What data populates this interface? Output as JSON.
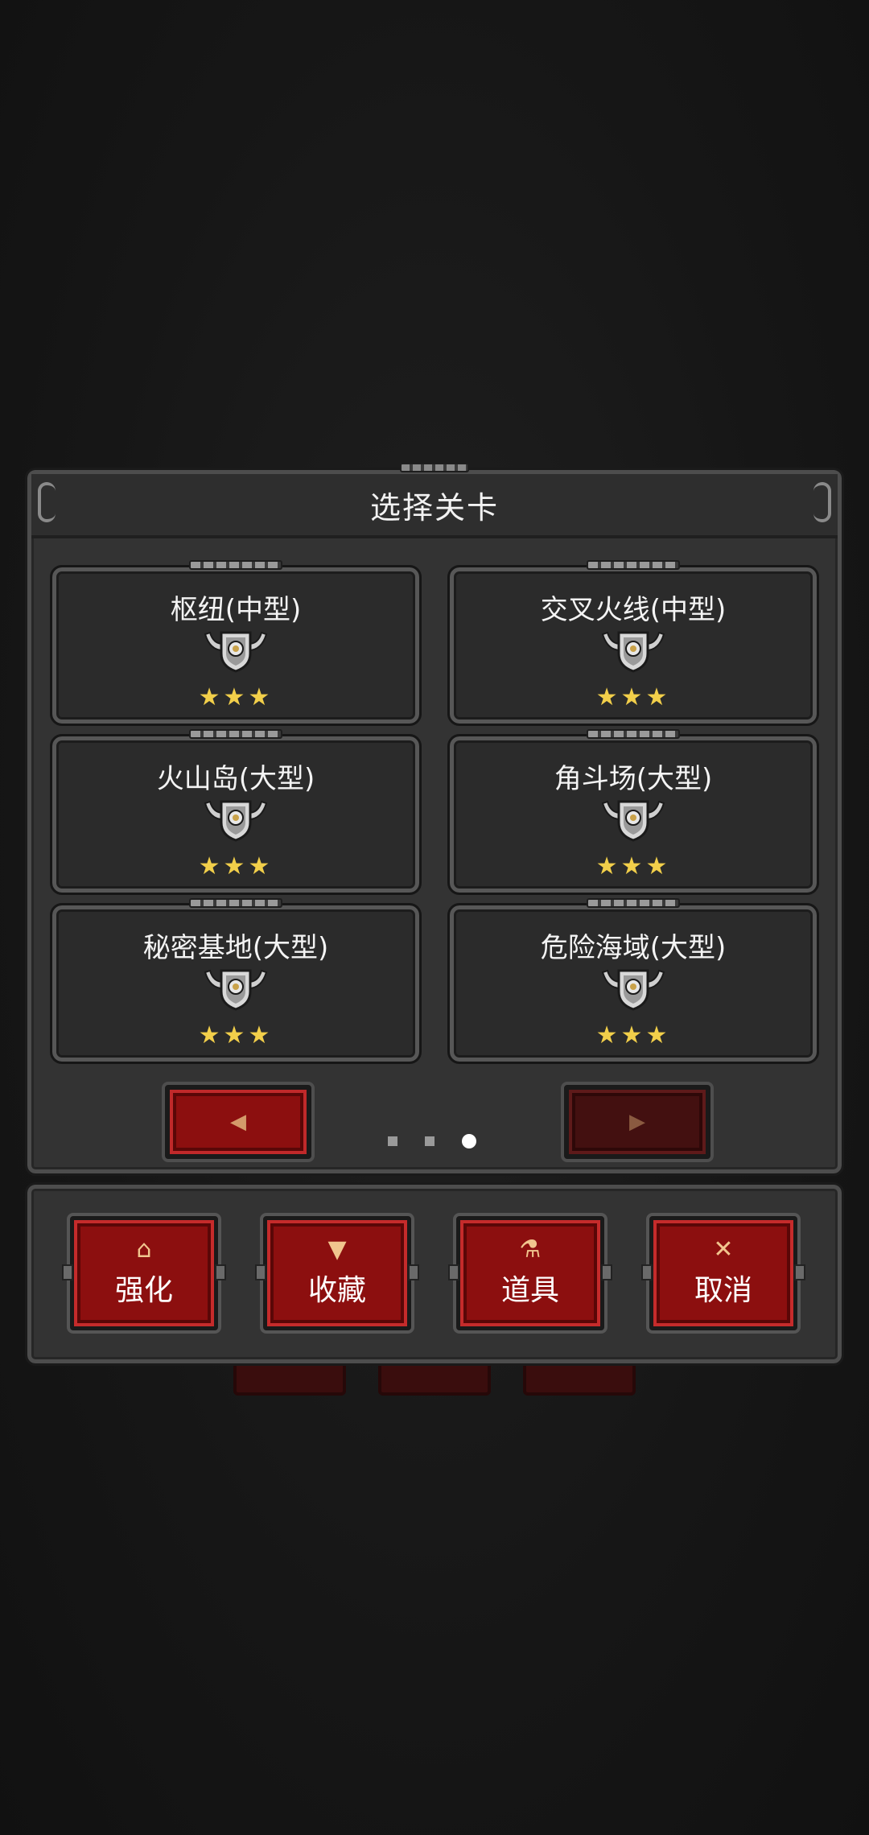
{
  "panel": {
    "title": "选择关卡"
  },
  "levels": [
    {
      "name": "枢纽(中型)",
      "stars": "★★★",
      "icon": "helmet-badge-icon"
    },
    {
      "name": "交叉火线(中型)",
      "stars": "★★★",
      "icon": "helmet-badge-icon"
    },
    {
      "name": "火山岛(大型)",
      "stars": "★★★",
      "icon": "helmet-badge-icon"
    },
    {
      "name": "角斗场(大型)",
      "stars": "★★★",
      "icon": "helmet-badge-icon"
    },
    {
      "name": "秘密基地(大型)",
      "stars": "★★★",
      "icon": "helmet-badge-icon"
    },
    {
      "name": "危险海域(大型)",
      "stars": "★★★",
      "icon": "helmet-badge-icon"
    }
  ],
  "pagination": {
    "prev_icon": "◀",
    "next_icon": "▶",
    "total_pages": 3,
    "current_page": 3
  },
  "actions": [
    {
      "label": "强化",
      "icon_glyph": "⌂",
      "icon": "upgrade-icon"
    },
    {
      "label": "收藏",
      "icon_glyph": "▼",
      "icon": "goblet-icon"
    },
    {
      "label": "道具",
      "icon_glyph": "⚗",
      "icon": "flask-icon"
    },
    {
      "label": "取消",
      "icon_glyph": "✕",
      "icon": "close-icon"
    }
  ],
  "colors": {
    "button_red": "#8c0f0f",
    "star_gold": "#f2cf4a",
    "panel_gray": "#333333"
  }
}
